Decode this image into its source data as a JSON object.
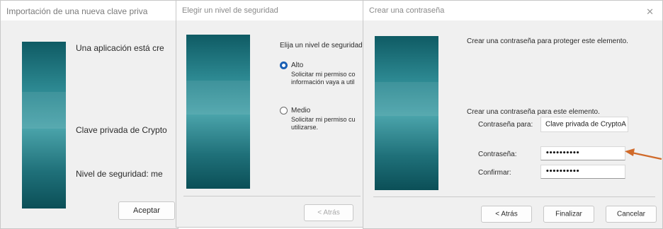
{
  "dialog1": {
    "title": "Importación de una nueva clave priva",
    "message": "Una aplicación está cre",
    "key_label": "Clave privada de Crypto",
    "security_level": "Nivel de seguridad: me",
    "accept_button": "Aceptar"
  },
  "dialog2": {
    "title": "Elegir un nivel de seguridad",
    "prompt": "Elija un nivel de seguridad",
    "options": [
      {
        "label": "Alto",
        "desc1": "Solicitar mi permiso co",
        "desc2": "información vaya a util",
        "selected": true
      },
      {
        "label": "Medio",
        "desc1": "Solicitar mi permiso cu",
        "desc2": "utilizarse.",
        "selected": false
      }
    ],
    "back_button": "< Atrás"
  },
  "dialog3": {
    "title": "Crear una contraseña",
    "close_glyph": "✕",
    "intro": "Crear una contraseña para proteger este elemento.",
    "for_element": "Crear una contraseña para este elemento.",
    "password_for_label": "Contraseña para:",
    "password_for_value": "Clave privada de CryptoA",
    "password_label": "Contraseña:",
    "password_value": "••••••••••",
    "confirm_label": "Confirmar:",
    "confirm_value": "••••••••••",
    "back_button": "< Atrás",
    "finish_button": "Finalizar",
    "cancel_button": "Cancelar"
  },
  "colors": {
    "arrow": "#d06a2a",
    "accent": "#1a5fb4",
    "banner": "#2c8891"
  },
  "icons": [
    "close-icon",
    "arrow-pointer-icon",
    "radio-selected-icon",
    "radio-unselected-icon"
  ]
}
